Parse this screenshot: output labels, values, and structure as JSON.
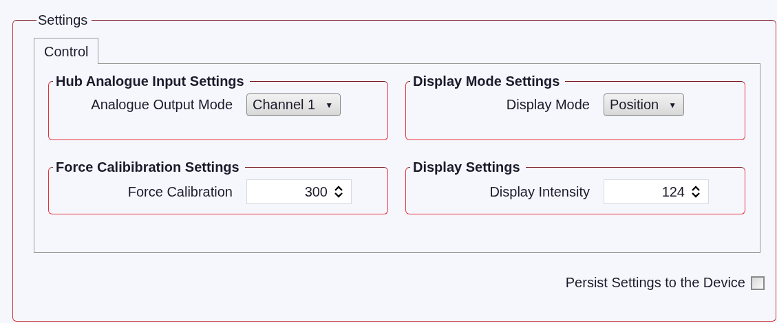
{
  "settings": {
    "title": "Settings",
    "tabs": [
      {
        "label": "Control",
        "selected": true
      }
    ],
    "groups": [
      {
        "title": "Hub Analogue Input Settings",
        "kind": "dropdown",
        "label": "Analogue Output Mode",
        "value": "Channel 1",
        "arrow": "▼"
      },
      {
        "title": "Display Mode Settings",
        "kind": "dropdown",
        "label": "Display Mode",
        "value": "Position",
        "arrow": "▼"
      },
      {
        "title": "Force Calibibration Settings",
        "kind": "spinner",
        "label": "Force Calibration",
        "value": "300"
      },
      {
        "title": "Display Settings",
        "kind": "spinner",
        "label": "Display Intensity",
        "value": "124"
      }
    ],
    "persist": {
      "label": "Persist Settings to the Device",
      "checked": false
    }
  }
}
